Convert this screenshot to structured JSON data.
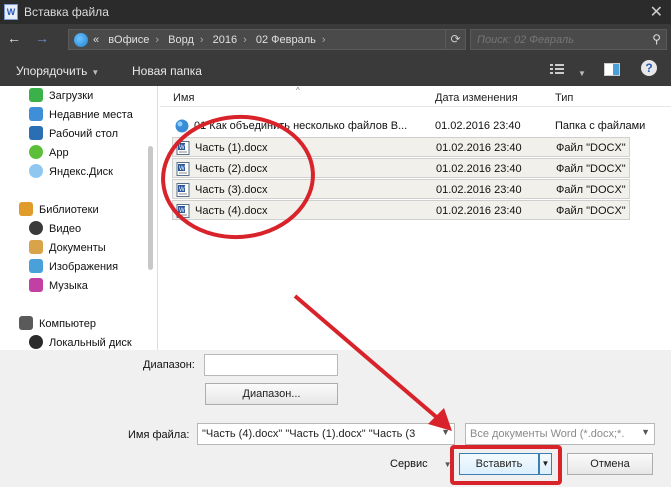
{
  "window": {
    "title": "Вставка файла",
    "app_icon_letter": "W"
  },
  "nav": {
    "back_label": "←",
    "forward_label": "→",
    "address_prefix": "«",
    "crumbs": [
      "вОфисе",
      "Ворд",
      "2016",
      "02 Февраль"
    ],
    "crumb_sep": "›",
    "search_placeholder": "Поиск: 02 Февраль"
  },
  "toolbar": {
    "organize_label": "Упорядочить",
    "new_folder_label": "Новая папка"
  },
  "sidebar": {
    "items": [
      {
        "label": "Загрузки",
        "color": "#3bb14a"
      },
      {
        "label": "Недавние места",
        "color": "#3f8fd8"
      },
      {
        "label": "Рабочий стол",
        "color": "#2a6fb3"
      },
      {
        "label": "App",
        "color": "#5cbf3a"
      },
      {
        "label": "Яндекс.Диск",
        "color": "#8fc7f0"
      },
      {
        "label": "Библиотеки",
        "color": "#e09b2b"
      },
      {
        "label": "Видео",
        "color": "#3a3a3a"
      },
      {
        "label": "Документы",
        "color": "#d9a34a"
      },
      {
        "label": "Изображения",
        "color": "#4aa0d8"
      },
      {
        "label": "Музыка",
        "color": "#c23fa3"
      },
      {
        "label": "Компьютер",
        "color": "#5a5a5a"
      },
      {
        "label": "Локальный диск",
        "color": "#2b2b2b"
      }
    ]
  },
  "files": {
    "columns": {
      "name": "Имя",
      "date": "Дата изменения",
      "type": "Тип"
    },
    "rows": [
      {
        "name": "01 Как объединить несколько файлов В...",
        "date": "01.02.2016 23:40",
        "type": "Папка с файлами",
        "selected": false,
        "kind": "folder"
      },
      {
        "name": "Часть  (1).docx",
        "date": "01.02.2016 23:40",
        "type": "Файл \"DOCX\"",
        "selected": true,
        "kind": "docx"
      },
      {
        "name": "Часть  (2).docx",
        "date": "01.02.2016 23:40",
        "type": "Файл \"DOCX\"",
        "selected": true,
        "kind": "docx"
      },
      {
        "name": "Часть  (3).docx",
        "date": "01.02.2016 23:40",
        "type": "Файл \"DOCX\"",
        "selected": true,
        "kind": "docx"
      },
      {
        "name": "Часть  (4).docx",
        "date": "01.02.2016 23:40",
        "type": "Файл \"DOCX\"",
        "selected": true,
        "kind": "docx"
      }
    ]
  },
  "bottom": {
    "range_label": "Диапазон:",
    "range_value": "",
    "range_button": "Диапазон...",
    "filename_label": "Имя файла:",
    "filename_value": "\"Часть  (4).docx\" \"Часть  (1).docx\" \"Часть  (3",
    "filetype_value": "Все документы Word (*.docx;*.",
    "service_label": "Сервис",
    "insert_label": "Вставить",
    "cancel_label": "Отмена"
  },
  "annotation_color": "#d8232a"
}
